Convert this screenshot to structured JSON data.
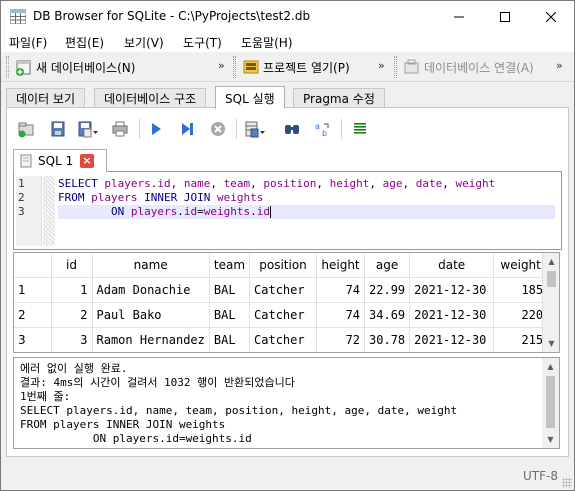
{
  "window": {
    "title": "DB Browser for SQLite - C:\\PyProjects\\test2.db",
    "min_label": "—",
    "max_label": "☐",
    "close_label": "✕"
  },
  "menu": [
    "파일(F)",
    "편집(E)",
    "보기(V)",
    "도구(T)",
    "도움말(H)"
  ],
  "toolbar": {
    "new_db": "새 데이터베이스(N)",
    "open_project": "프로젝트 열기(P)",
    "attach_db": "데이터베이스 연결(A)",
    "more": "»"
  },
  "main_tabs": [
    "데이터 보기",
    "데이터베이스 구조",
    "SQL 실행",
    "Pragma 수정"
  ],
  "active_main_tab": "SQL 실행",
  "editor_tab": {
    "label": "SQL 1",
    "close": "×"
  },
  "editor": {
    "line_numbers": [
      "1",
      "2",
      "3"
    ],
    "lines": [
      [
        {
          "t": "SELECT ",
          "k": "kw"
        },
        {
          "t": "players",
          "k": "id"
        },
        {
          "t": ".",
          "k": "op"
        },
        {
          "t": "id",
          "k": "id"
        },
        {
          "t": ", ",
          "k": "op"
        },
        {
          "t": "name",
          "k": "id"
        },
        {
          "t": ", ",
          "k": "op"
        },
        {
          "t": "team",
          "k": "id"
        },
        {
          "t": ", ",
          "k": "op"
        },
        {
          "t": "position",
          "k": "id"
        },
        {
          "t": ", ",
          "k": "op"
        },
        {
          "t": "height",
          "k": "id"
        },
        {
          "t": ", ",
          "k": "op"
        },
        {
          "t": "age",
          "k": "id"
        },
        {
          "t": ", ",
          "k": "op"
        },
        {
          "t": "date",
          "k": "id"
        },
        {
          "t": ", ",
          "k": "op"
        },
        {
          "t": "weight",
          "k": "id"
        }
      ],
      [
        {
          "t": "FROM ",
          "k": "kw"
        },
        {
          "t": "players ",
          "k": "id"
        },
        {
          "t": "INNER JOIN ",
          "k": "kw"
        },
        {
          "t": "weights",
          "k": "id"
        }
      ],
      [
        {
          "t": "        ON ",
          "k": "kw"
        },
        {
          "t": "players",
          "k": "id"
        },
        {
          "t": ".",
          "k": "op"
        },
        {
          "t": "id",
          "k": "id"
        },
        {
          "t": "=",
          "k": "op"
        },
        {
          "t": "weights",
          "k": "id"
        },
        {
          "t": ".",
          "k": "op"
        },
        {
          "t": "id",
          "k": "id"
        }
      ]
    ]
  },
  "results": {
    "columns": [
      "id",
      "name",
      "team",
      "position",
      "height",
      "age",
      "date",
      "weight"
    ],
    "rows": [
      {
        "row_no": "1",
        "cells": [
          "1",
          "Adam Donachie",
          "BAL",
          "Catcher",
          "74",
          "22.99",
          "2021-12-30",
          "185"
        ]
      },
      {
        "row_no": "2",
        "cells": [
          "2",
          "Paul Bako",
          "BAL",
          "Catcher",
          "74",
          "34.69",
          "2021-12-30",
          "220"
        ]
      },
      {
        "row_no": "3",
        "cells": [
          "3",
          "Ramon Hernandez",
          "BAL",
          "Catcher",
          "72",
          "30.78",
          "2021-12-30",
          "215"
        ]
      }
    ],
    "numeric_cols": [
      0,
      4,
      5,
      7
    ]
  },
  "messages": [
    "에러 없이 실행 완료.",
    "결과: 4ms의 시간이 걸려서 1032 행이 반환되었습니다",
    "1번째 줄:",
    "SELECT players.id, name, team, position, height, age, date, weight",
    "FROM players INNER JOIN weights",
    "           ON players.id=weights.id"
  ],
  "status": {
    "encoding": "UTF-8"
  },
  "scroll_arrows": {
    "up": "▲",
    "down": "▼"
  }
}
